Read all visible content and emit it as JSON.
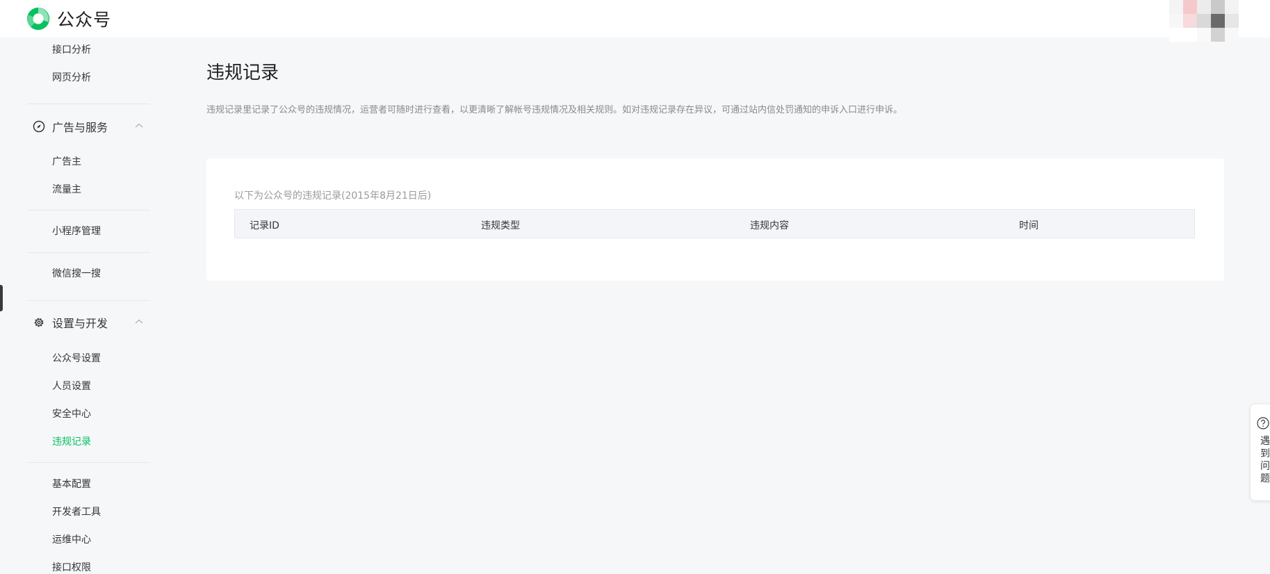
{
  "header": {
    "app_name": "公众号",
    "brand_color": "#07c160"
  },
  "sidebar": {
    "top_items": [
      "接口分析",
      "网页分析"
    ],
    "groups": [
      {
        "label": "广告与服务",
        "icon": "compass-icon",
        "items": [
          "广告主",
          "流量主"
        ]
      },
      {
        "label": "设置与开发",
        "icon": "gear-icon",
        "items": [
          "公众号设置",
          "人员设置",
          "安全中心",
          "违规记录"
        ]
      }
    ],
    "standalone_items": [
      "小程序管理",
      "微信搜一搜"
    ],
    "dev_items": [
      "基本配置",
      "开发者工具",
      "运维中心",
      "接口权限"
    ],
    "active_item": "违规记录"
  },
  "main": {
    "title": "违规记录",
    "description": "违规记录里记录了公众号的违规情况，运营者可随时进行查看，以更清晰了解帐号违规情况及相关规则。如对违规记录存在异议，可通过站内信处罚通知的申诉入口进行申诉。",
    "card_note": "以下为公众号的违规记录(2015年8月21日后)",
    "table_headers": [
      "记录ID",
      "违规类型",
      "违规内容",
      "时间"
    ]
  },
  "help": {
    "label": "遇到问题"
  }
}
